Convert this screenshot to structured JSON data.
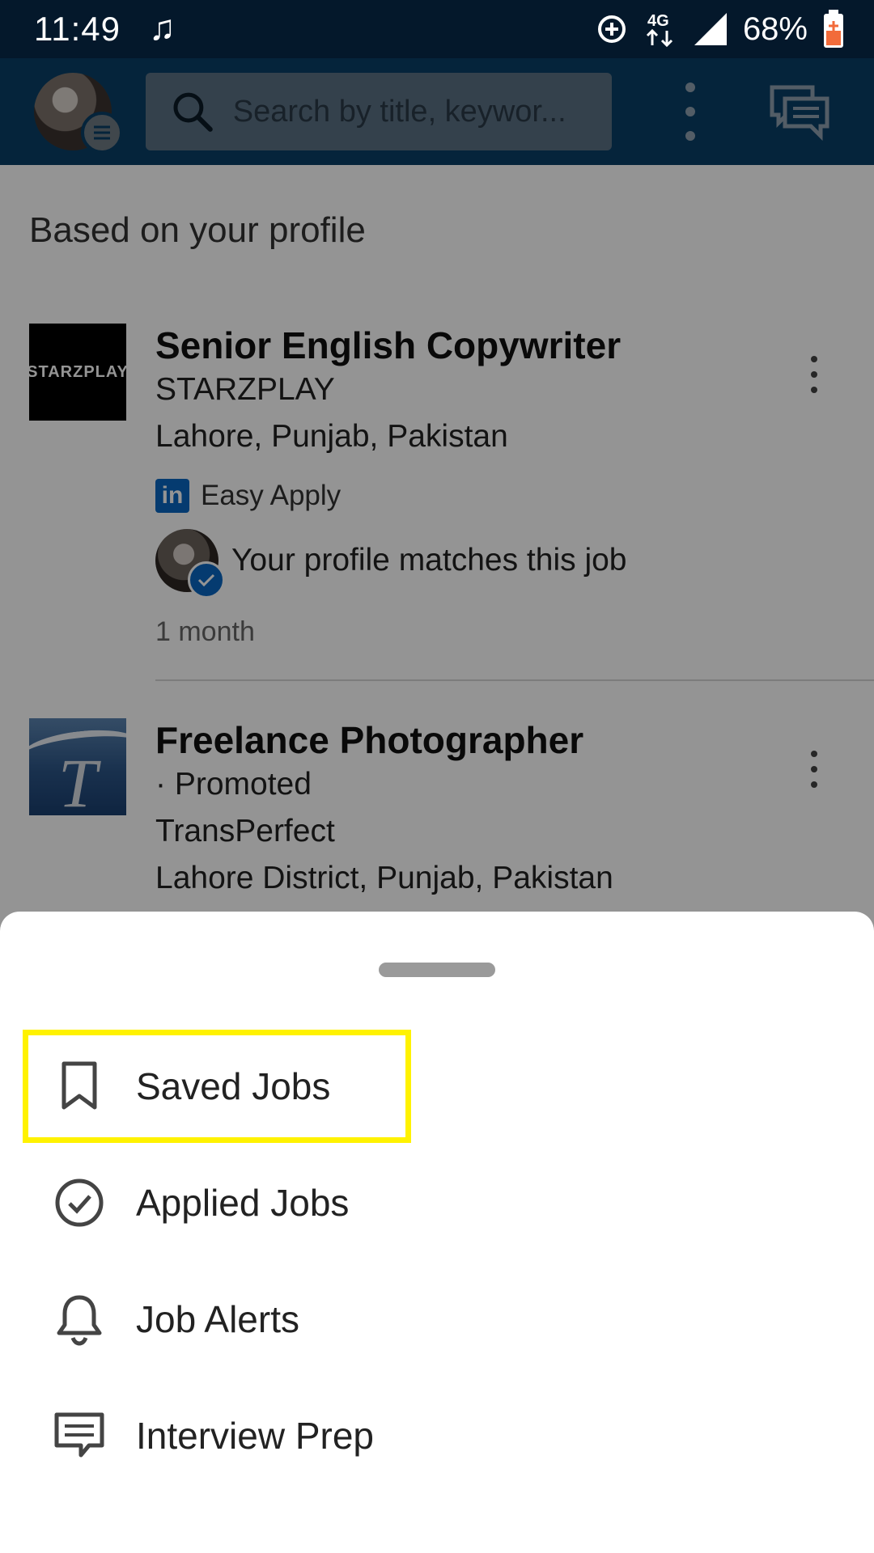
{
  "status_bar": {
    "time": "11:49",
    "network": "4G",
    "battery": "68%",
    "icons": [
      "music-note-icon",
      "data-saver-icon",
      "network-4g-icon",
      "signal-icon",
      "battery-charging-icon"
    ]
  },
  "app_bar": {
    "search_placeholder": "Search by title, keywor...",
    "icons": [
      "avatar",
      "menu-icon",
      "search-icon",
      "more-vert-icon",
      "messaging-icon"
    ]
  },
  "feed": {
    "section_title": "Based on your profile",
    "jobs": [
      {
        "title": "Senior English Copywriter",
        "company": "STARZPLAY",
        "logo_text": "STARZPLAY",
        "location": "Lahore, Punjab, Pakistan",
        "easy_apply": "Easy Apply",
        "match_text": "Your profile matches this job",
        "posted": "1 month"
      },
      {
        "title": "Freelance Photographer",
        "promoted": "· Promoted",
        "company": "TransPerfect",
        "logo_text": "T",
        "location": "Lahore District, Punjab, Pakistan"
      }
    ]
  },
  "sheet": {
    "items": [
      {
        "label": "Saved Jobs",
        "icon": "bookmark-icon",
        "highlighted": true
      },
      {
        "label": "Applied Jobs",
        "icon": "check-circle-icon"
      },
      {
        "label": "Job Alerts",
        "icon": "bell-icon"
      },
      {
        "label": "Interview Prep",
        "icon": "chat-bubble-icon"
      }
    ]
  },
  "colors": {
    "status_bar_bg": "#04182b",
    "app_bar_bg": "#0a3f66",
    "linkedin_blue": "#0a66c2",
    "highlight": "#fff200"
  }
}
